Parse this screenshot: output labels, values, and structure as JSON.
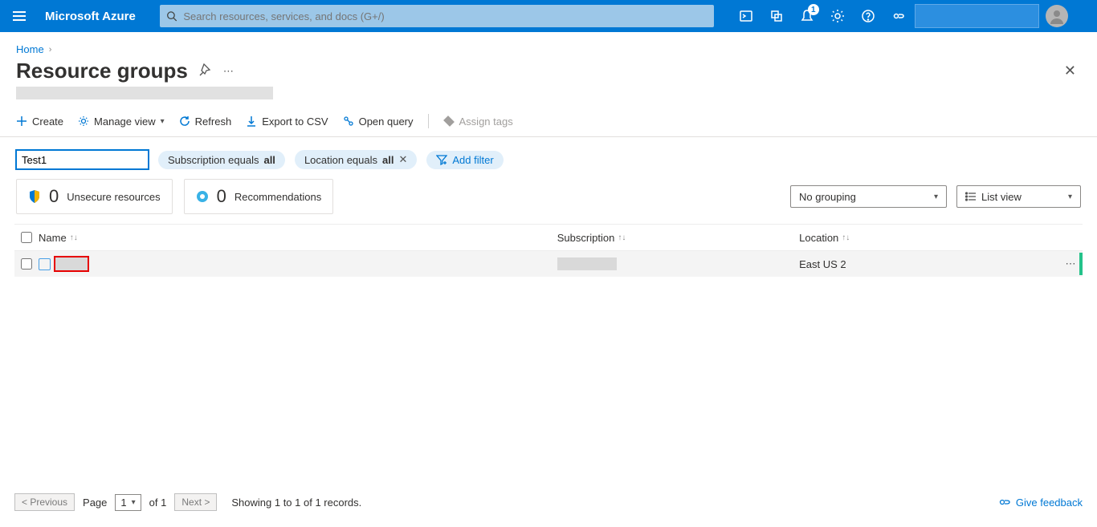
{
  "top": {
    "brand": "Microsoft Azure",
    "search_placeholder": "Search resources, services, and docs (G+/)",
    "notification_badge": "1",
    "account_text": ""
  },
  "breadcrumb": {
    "home": "Home"
  },
  "page": {
    "title": "Resource groups"
  },
  "toolbar": {
    "create": "Create",
    "manage_view": "Manage view",
    "refresh": "Refresh",
    "export_csv": "Export to CSV",
    "open_query": "Open query",
    "assign_tags": "Assign tags"
  },
  "filters": {
    "search_value": "Test1",
    "sub_prefix": "Subscription equals ",
    "sub_value": "all",
    "loc_prefix": "Location equals ",
    "loc_value": "all",
    "add_filter": "Add filter"
  },
  "cards": {
    "unsecure_count": "0",
    "unsecure_label": "Unsecure resources",
    "rec_count": "0",
    "rec_label": "Recommendations"
  },
  "view": {
    "grouping": "No grouping",
    "listview": "List view"
  },
  "table": {
    "col_name": "Name",
    "col_sub": "Subscription",
    "col_loc": "Location",
    "rows": [
      {
        "name": "",
        "subscription": "",
        "location": "East US 2"
      }
    ]
  },
  "pager": {
    "prev": "< Previous",
    "page_label": "Page",
    "page_num": "1",
    "of_label": "of 1",
    "next": "Next >",
    "showing": "Showing 1 to 1 of 1 records.",
    "feedback": "Give feedback"
  }
}
